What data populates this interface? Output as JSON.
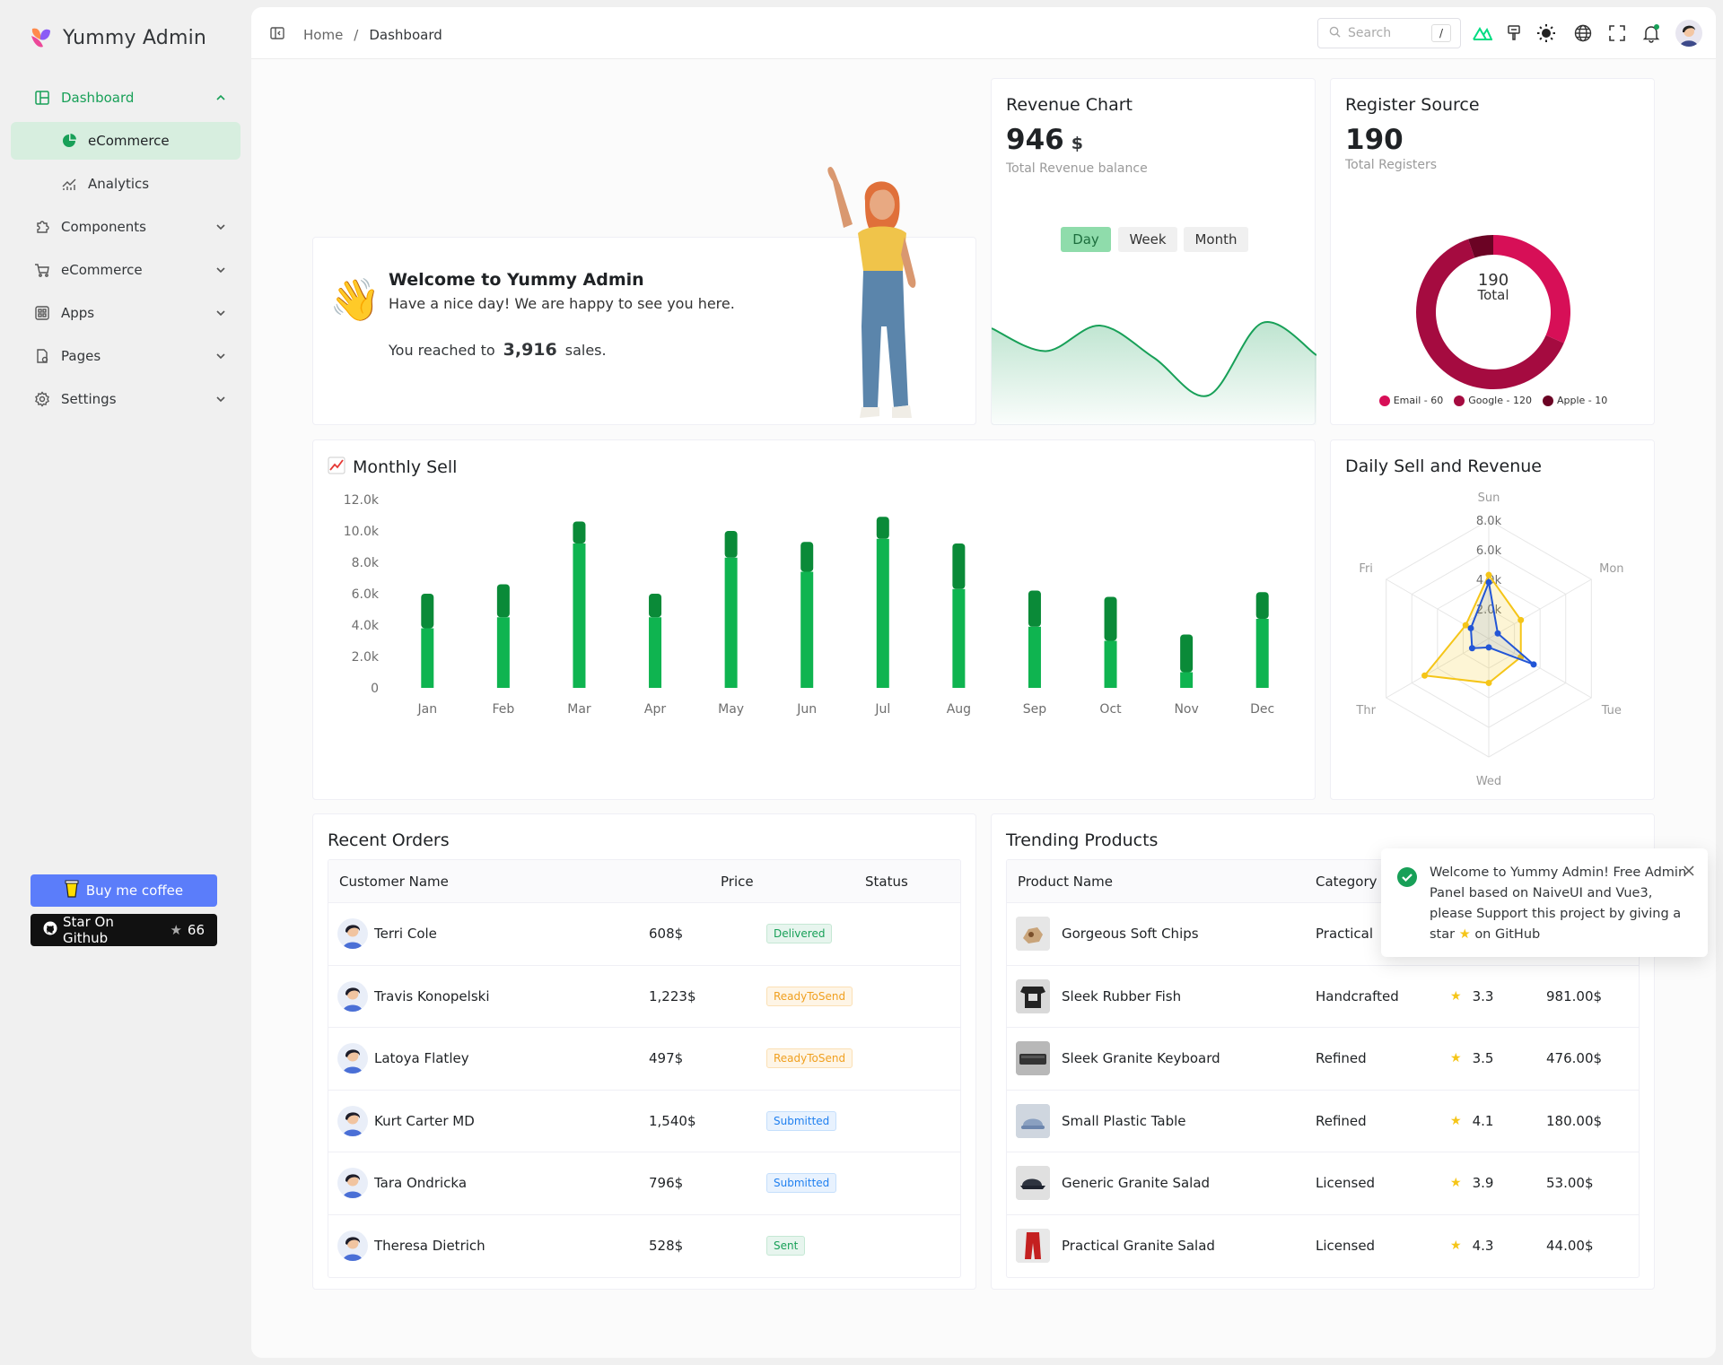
{
  "brand": {
    "title": "Yummy Admin"
  },
  "sidebar": {
    "items": [
      {
        "label": "Dashboard"
      },
      {
        "label": "eCommerce"
      },
      {
        "label": "Analytics"
      },
      {
        "label": "Components"
      },
      {
        "label": "eCommerce"
      },
      {
        "label": "Apps"
      },
      {
        "label": "Pages"
      },
      {
        "label": "Settings"
      }
    ],
    "coffee_label": "Buy me coffee",
    "github_label": "Star On Github",
    "github_stars": "66"
  },
  "header": {
    "breadcrumb": [
      "Home",
      "/",
      "Dashboard"
    ],
    "search_placeholder": "Search",
    "search_shortcut": "/"
  },
  "welcome": {
    "title": "Welcome to Yummy Admin",
    "subtitle": "Have a nice day! We are happy to see you here.",
    "reach_prefix": "You reached to",
    "reach_value": "3,916",
    "reach_suffix": "sales."
  },
  "revenue": {
    "title": "Revenue Chart",
    "value": "946",
    "unit": "$",
    "caption": "Total Revenue balance",
    "ranges": [
      "Day",
      "Week",
      "Month"
    ],
    "selected_range": "Day"
  },
  "register": {
    "title": "Register Source",
    "value": "190",
    "caption": "Total Registers",
    "center_value": "190",
    "center_label": "Total"
  },
  "monthly": {
    "icon": "chart-increasing-emoji",
    "title": "Monthly Sell"
  },
  "daily": {
    "title": "Daily Sell and Revenue"
  },
  "chart_data": [
    {
      "type": "area",
      "title": "Revenue Chart",
      "x": [
        0,
        1,
        2,
        3,
        4,
        5,
        6
      ],
      "y": [
        7.2,
        5.5,
        7.4,
        5.0,
        2.2,
        7.6,
        5.2
      ],
      "color": "#18a058"
    },
    {
      "type": "pie",
      "title": "Register Source",
      "labels": [
        "Email - 60",
        "Google - 120",
        "Apple - 10"
      ],
      "values": [
        60,
        120,
        10
      ],
      "colors": [
        "#d70f57",
        "#a50b40",
        "#6b0324"
      ],
      "legend": "bottom"
    },
    {
      "type": "bar",
      "title": "Monthly Sell",
      "categories": [
        "Jan",
        "Feb",
        "Mar",
        "Apr",
        "May",
        "Jun",
        "Jul",
        "Aug",
        "Sep",
        "Oct",
        "Nov",
        "Dec"
      ],
      "series": [
        {
          "values": [
            3800,
            4500,
            9200,
            4500,
            8300,
            7400,
            9500,
            6300,
            3900,
            3000,
            1000,
            4400
          ],
          "color": "#0fb450"
        },
        {
          "values": [
            2200,
            2100,
            1400,
            1500,
            1700,
            1900,
            1400,
            2900,
            2300,
            2800,
            2400,
            1700
          ],
          "color": "#0a8a38"
        }
      ],
      "yticks": [
        "0",
        "2.0k",
        "4.0k",
        "6.0k",
        "8.0k",
        "10.0k",
        "12.0k"
      ],
      "ylim": [
        0,
        12000
      ],
      "stacked": true
    },
    {
      "type": "radar",
      "title": "Daily Sell and Revenue",
      "indicators": [
        "Sun",
        "Mon",
        "Tue",
        "Wed",
        "Thr",
        "Fri"
      ],
      "rings": [
        "8.0k",
        "6.0k",
        "4.0k",
        "2.0k"
      ],
      "max": 8000,
      "series": [
        {
          "values": [
            4300,
            2500,
            2500,
            3000,
            5000,
            1800
          ],
          "color": "#f5c518"
        },
        {
          "values": [
            3800,
            700,
            3500,
            600,
            1300,
            1400
          ],
          "color": "#2255d6"
        }
      ]
    }
  ],
  "orders": {
    "title": "Recent Orders",
    "columns": [
      "Customer Name",
      "Price",
      "Status"
    ],
    "rows": [
      {
        "name": "Terri Cole",
        "price": "608$",
        "status": "Delivered",
        "tone": "green"
      },
      {
        "name": "Travis Konopelski",
        "price": "1,223$",
        "status": "ReadyToSend",
        "tone": "orange"
      },
      {
        "name": "Latoya Flatley",
        "price": "497$",
        "status": "ReadyToSend",
        "tone": "orange"
      },
      {
        "name": "Kurt Carter MD",
        "price": "1,540$",
        "status": "Submitted",
        "tone": "blue"
      },
      {
        "name": "Tara Ondricka",
        "price": "796$",
        "status": "Submitted",
        "tone": "blue"
      },
      {
        "name": "Theresa Dietrich",
        "price": "528$",
        "status": "Sent",
        "tone": "green"
      }
    ]
  },
  "products": {
    "title": "Trending Products",
    "columns": [
      "Product Name",
      "Category"
    ],
    "rows": [
      {
        "name": "Gorgeous Soft Chips",
        "category": "Practical",
        "rating": "",
        "price": ""
      },
      {
        "name": "Sleek Rubber Fish",
        "category": "Handcrafted",
        "rating": "3.3",
        "price": "981.00$"
      },
      {
        "name": "Sleek Granite Keyboard",
        "category": "Refined",
        "rating": "3.5",
        "price": "476.00$"
      },
      {
        "name": "Small Plastic Table",
        "category": "Refined",
        "rating": "4.1",
        "price": "180.00$"
      },
      {
        "name": "Generic Granite Salad",
        "category": "Licensed",
        "rating": "3.9",
        "price": "53.00$"
      },
      {
        "name": "Practical Granite Salad",
        "category": "Licensed",
        "rating": "4.3",
        "price": "44.00$"
      }
    ]
  },
  "toast": {
    "message_pre": "Welcome to Yummy Admin! Free Admin Panel based on NaiveUI and Vue3, please Support this project by giving a star",
    "message_post": "on GitHub"
  }
}
